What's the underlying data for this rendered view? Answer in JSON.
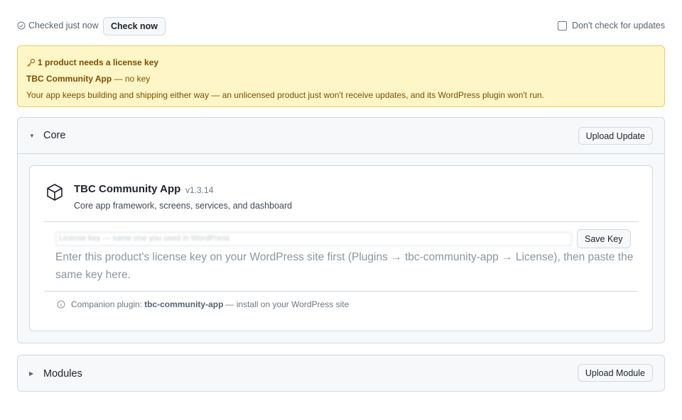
{
  "topbar": {
    "checked_text": "Checked just now",
    "check_button": "Check now",
    "dont_check_label": "Don't check for updates",
    "dont_check_checked": false
  },
  "alert": {
    "title": "1 product needs a license key",
    "product_name": "TBC Community App",
    "product_status": "— no key",
    "message": "Your app keeps building and shipping either way — an unlicensed product just won't receive updates, and its WordPress plugin won't run."
  },
  "core": {
    "title": "Core",
    "expanded": true,
    "upload_button": "Upload Update",
    "product": {
      "icon": "package-icon",
      "name": "TBC Community App",
      "version": "v1.3.14",
      "description": "Core app framework, screens, services, and dashboard",
      "key_placeholder": "License key — same one you used in WordPress",
      "save_button": "Save Key",
      "hint": "Enter this product's license key on your WordPress site first (Plugins → tbc-community-app → License), then paste the same key here.",
      "companion_prefix": "Companion plugin:",
      "companion_plugin": "tbc-community-app",
      "companion_suffix": "— install on your WordPress site"
    }
  },
  "modules": {
    "title": "Modules",
    "expanded": false,
    "upload_button": "Upload Module"
  },
  "colors": {
    "alert_bg": "#fff6c7",
    "alert_border": "#e9cd5a",
    "alert_text": "#7d4e00"
  }
}
